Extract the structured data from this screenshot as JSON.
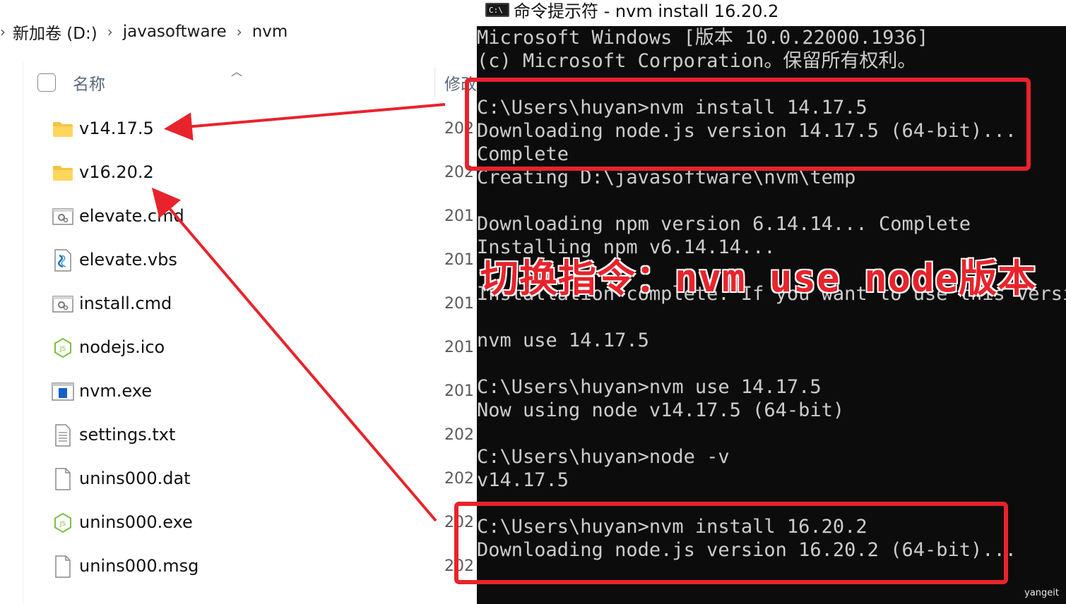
{
  "explorer": {
    "breadcrumb": [
      "新加卷 (D:)",
      "javasoftware",
      "nvm"
    ],
    "column_name": "名称",
    "column_modified": "修改",
    "files": [
      {
        "name": "v14.17.5",
        "icon": "folder-icon",
        "date": "202"
      },
      {
        "name": "v16.20.2",
        "icon": "folder-icon",
        "date": "202"
      },
      {
        "name": "elevate.cmd",
        "icon": "cmd-script-icon",
        "date": "201"
      },
      {
        "name": "elevate.vbs",
        "icon": "vbs-script-icon",
        "date": "201"
      },
      {
        "name": "install.cmd",
        "icon": "cmd-script-icon",
        "date": "201"
      },
      {
        "name": "nodejs.ico",
        "icon": "nodejs-icon",
        "date": "201"
      },
      {
        "name": "nvm.exe",
        "icon": "exe-icon",
        "date": "201"
      },
      {
        "name": "settings.txt",
        "icon": "text-file-icon",
        "date": "202"
      },
      {
        "name": "unins000.dat",
        "icon": "blank-file-icon",
        "date": "202"
      },
      {
        "name": "unins000.exe",
        "icon": "nodejs-icon",
        "date": "202"
      },
      {
        "name": "unins000.msg",
        "icon": "blank-file-icon",
        "date": "202"
      }
    ]
  },
  "console": {
    "title": "命令提示符 - nvm  install 16.20.2",
    "icon_label": "C:\\",
    "lines": [
      "Microsoft Windows [版本 10.0.22000.1936]",
      "(c) Microsoft Corporation。保留所有权利。",
      "",
      "C:\\Users\\huyan>nvm install 14.17.5",
      "Downloading node.js version 14.17.5 (64-bit)...",
      "Complete",
      "Creating D:\\javasoftware\\nvm\\temp",
      "",
      "Downloading npm version 6.14.14... Complete",
      "Installing npm v6.14.14...",
      "",
      "Installation complete. If you want to use this versi",
      "",
      "nvm use 14.17.5",
      "",
      "C:\\Users\\huyan>nvm use 14.17.5",
      "Now using node v14.17.5 (64-bit)",
      "",
      "C:\\Users\\huyan>node -v",
      "v14.17.5",
      "",
      "C:\\Users\\huyan>nvm install 16.20.2",
      "Downloading node.js version 16.20.2 (64-bit)..."
    ]
  },
  "annotation": {
    "text": "切换指令：nvm use node版本",
    "color": "#e8232b"
  },
  "watermark": "yangeit"
}
